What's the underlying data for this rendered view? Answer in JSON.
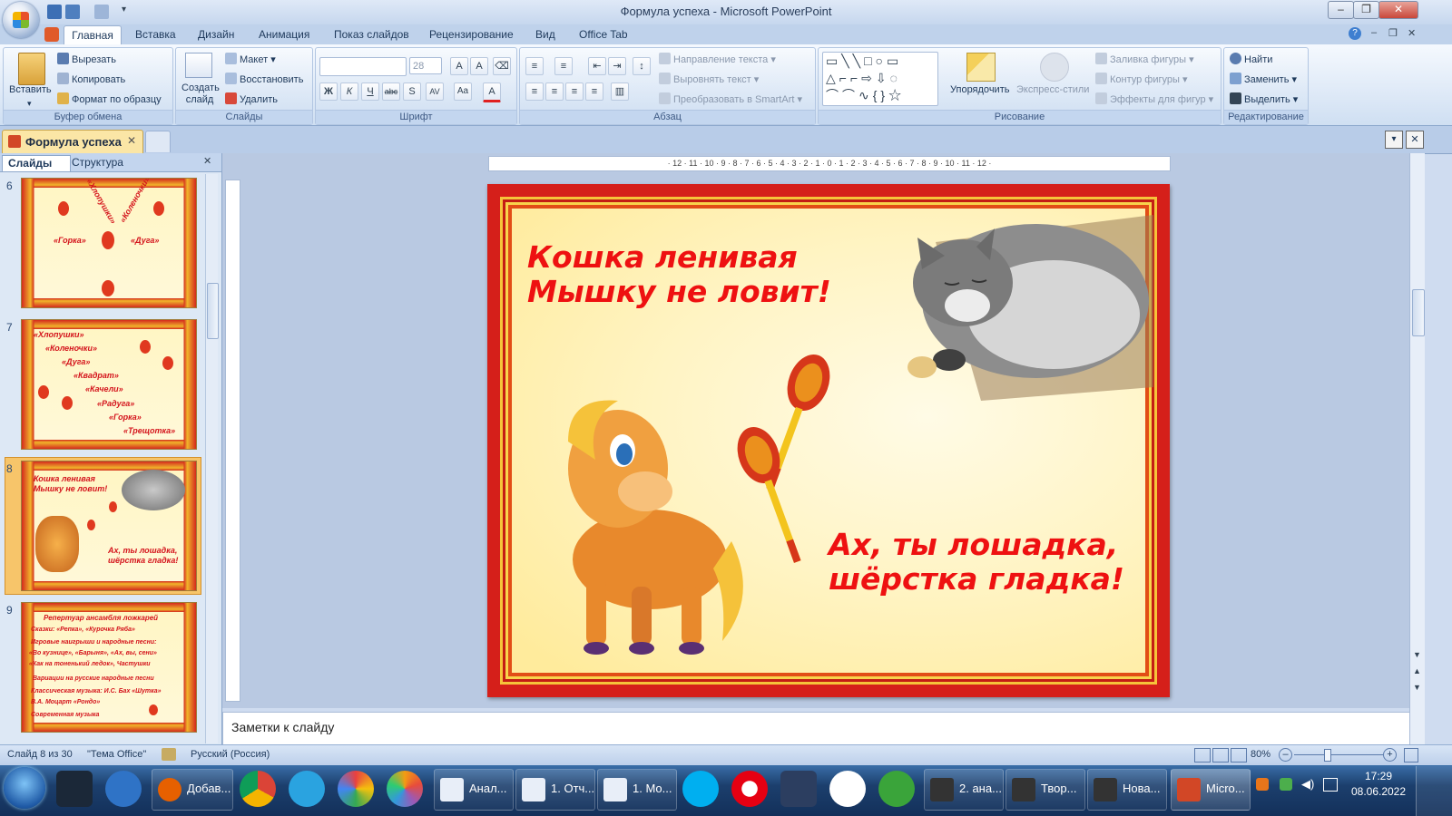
{
  "window": {
    "title": "Формула успеха - Microsoft PowerPoint"
  },
  "ribbon_tabs": [
    "Главная",
    "Вставка",
    "Дизайн",
    "Анимация",
    "Показ слайдов",
    "Рецензирование",
    "Вид",
    "Office Tab"
  ],
  "clipboard": {
    "paste": "Вставить",
    "cut": "Вырезать",
    "copy": "Копировать",
    "format_painter": "Формат по образцу",
    "label": "Буфер обмена"
  },
  "slides_group": {
    "new_slide": "Создать слайд",
    "layout": "Макет",
    "reset": "Восстановить",
    "delete": "Удалить",
    "label": "Слайды"
  },
  "font_group": {
    "font_size": "28",
    "label": "Шрифт"
  },
  "paragraph_group": {
    "text_direction": "Направление текста",
    "align_text": "Выровнять текст",
    "smartart": "Преобразовать в SmartArt",
    "label": "Абзац"
  },
  "drawing_group": {
    "arrange": "Упорядочить",
    "quick_styles": "Экспресс-стили",
    "fill": "Заливка фигуры",
    "outline": "Контур фигуры",
    "effects": "Эффекты для фигур",
    "label": "Рисование"
  },
  "editing_group": {
    "find": "Найти",
    "replace": "Заменить",
    "select": "Выделить",
    "label": "Редактирование"
  },
  "document_tab": "Формула успеха",
  "left_pane": {
    "tab_slides": "Слайды",
    "tab_outline": "Структура"
  },
  "thumbnails": [
    {
      "num": "6",
      "lines": [
        "«Горка»",
        "«Дуга»",
        "«Коленочки»",
        "«Хлопушки»"
      ]
    },
    {
      "num": "7",
      "lines": [
        "«Хлопушки»",
        "«Коленочки»",
        "«Дуга»",
        "«Квадрат»",
        "«Качели»",
        "«Радуга»",
        "«Горка»",
        "«Трещотка»"
      ]
    },
    {
      "num": "8",
      "lines": [
        "Кошка ленивая",
        "Мышку не ловит!",
        "Ах, ты лошадка,",
        "шёрстка гладка!"
      ]
    },
    {
      "num": "9",
      "lines": [
        "Репертуар ансамбля ложкарей",
        "Сказки:   «Репка»,   «Курочка Ряба»",
        "Игровые наигрыши и народные песни:",
        "«Во кузнице», «Барыня», «Ах, вы, сени»",
        "«Как на тоненький ледок»,  Частушки",
        "Вариации на русские народные песни",
        "Классическая музыка: И.С. Бах «Шутка»",
        "В.А. Моцарт «Рондо»",
        "Современная музыка"
      ]
    }
  ],
  "ruler_h": "· 12 · 11 · 10 · 9 · 8 · 7 · 6 · 5 · 4 · 3 · 2 · 1 · 0 · 1 · 2 · 3 · 4 · 5 · 6 · 7 · 8 · 9 · 10 · 11 · 12 ·",
  "slide": {
    "text_top": [
      "Кошка ленивая",
      "Мышку не ловит!"
    ],
    "text_bottom": [
      "Ах, ты лошадка,",
      "шёрстка гладка!"
    ]
  },
  "notes_placeholder": "Заметки к слайду",
  "status": {
    "slide_info": "Слайд 8 из 30",
    "theme": "\"Тема Office\"",
    "language": "Русский (Россия)",
    "zoom": "80%"
  },
  "taskbar": {
    "buttons": [
      "Добав...",
      "Анал...",
      "1. Отч...",
      "1. Мо...",
      "2. ана...",
      "Твор...",
      "Нова...",
      "Micro..."
    ],
    "time": "17:29",
    "date": "08.06.2022"
  },
  "colors": {
    "slide_text": "#ee1111",
    "frame_red": "#d51f1a",
    "frame_gold": "#f6c33a"
  }
}
